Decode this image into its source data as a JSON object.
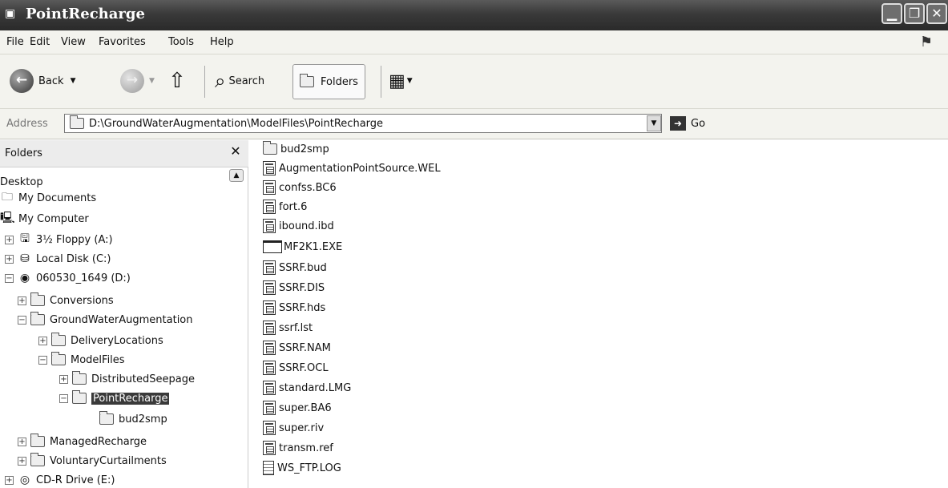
{
  "window": {
    "title": "PointRecharge"
  },
  "menu": [
    "File",
    "Edit",
    "View",
    "Favorites",
    "Tools",
    "Help"
  ],
  "toolbar": {
    "back": "Back",
    "search": "Search",
    "folders": "Folders"
  },
  "address": {
    "label": "Address",
    "value": "D:\\GroundWaterAugmentation\\ModelFiles\\PointRecharge",
    "go": "Go"
  },
  "folders_pane": {
    "title": "Folders",
    "tree": [
      "Desktop",
      "My Documents",
      "My Computer",
      "3½ Floppy (A:)",
      "Local Disk (C:)",
      "060530_1649 (D:)",
      "Conversions",
      "GroundWaterAugmentation",
      "DeliveryLocations",
      "ModelFiles",
      "DistributedSeepage",
      "PointRecharge",
      "bud2smp",
      "ManagedRecharge",
      "VoluntaryCurtailments",
      "CD-R Drive (E:)"
    ]
  },
  "files": [
    "bud2smp",
    "AugmentationPointSource.WEL",
    "confss.BC6",
    "fort.6",
    "ibound.ibd",
    "MF2K1.EXE",
    "SSRF.bud",
    "SSRF.DIS",
    "SSRF.hds",
    "ssrf.lst",
    "SSRF.NAM",
    "SSRF.OCL",
    "standard.LMG",
    "super.BA6",
    "super.riv",
    "transm.ref",
    "WS_FTP.LOG"
  ]
}
